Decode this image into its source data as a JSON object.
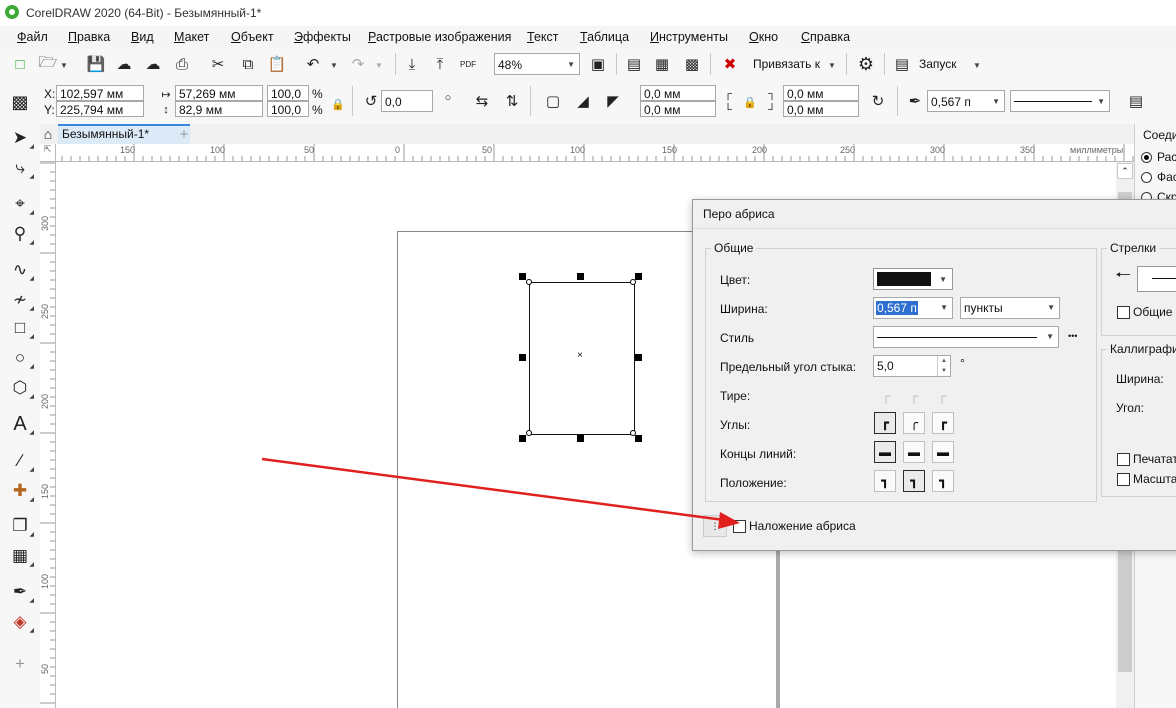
{
  "window": {
    "title": "CorelDRAW 2020 (64-Bit) - Безымянный-1*"
  },
  "menu": [
    "Файл",
    "Правка",
    "Вид",
    "Макет",
    "Объект",
    "Эффекты",
    "Растровые изображения",
    "Текст",
    "Таблица",
    "Инструменты",
    "Окно",
    "Справка"
  ],
  "toolbar": {
    "zoom": "48%",
    "snap_label": "Привязать к",
    "launch_label": "Запуск",
    "pdf_label": "PDF"
  },
  "props": {
    "x": "102,597 мм",
    "y": "225,794 мм",
    "w": "57,269 мм",
    "h": "82,9 мм",
    "sx": "100,0",
    "sy": "100,0",
    "pct": "%",
    "angle": "0,0",
    "r1": "0,0 мм",
    "r2": "0,0 мм",
    "r3": "0,0 мм",
    "r4": "0,0 мм",
    "outline_width": "0,567 п"
  },
  "tabs": {
    "doc": "Безымянный-1*"
  },
  "ruler": {
    "units": "миллиметры",
    "h_ticks": [
      "150",
      "100",
      "50",
      "0",
      "50",
      "100",
      "150",
      "200",
      "250",
      "300",
      "350"
    ],
    "v_ticks": [
      "300",
      "250",
      "200",
      "150",
      "100",
      "50"
    ]
  },
  "docker": {
    "title": "Соеди",
    "opts": [
      "Рас",
      "Фас",
      "Скр"
    ]
  },
  "dialog": {
    "title": "Перо абриса",
    "general_title": "Общие",
    "color_label": "Цвет:",
    "width_label": "Ширина:",
    "width_value": "0,567 п",
    "unit_value": "пункты",
    "style_label": "Стиль",
    "miter_label": "Предельный угол стыка:",
    "miter_value": "5,0",
    "degree": "°",
    "dash_label": "Тире:",
    "corners_label": "Углы:",
    "caps_label": "Концы линий:",
    "position_label": "Положение:",
    "arrows_title": "Стрелки",
    "arrows_common": "Общие",
    "calli_title": "Каллиграфи",
    "calli_width": "Ширина:",
    "calli_angle": "Угол:",
    "print_label": "Печатат",
    "scale_label": "Масшта",
    "overprint_label": "Наложение абриса",
    "more": "•••"
  },
  "colors": {
    "accent": "#3a86d8",
    "arrow": "#e0201d",
    "outline": "#111111"
  }
}
